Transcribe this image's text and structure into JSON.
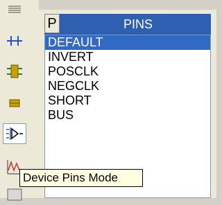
{
  "panel": {
    "header_button_label": "P",
    "title": "PINS",
    "items": [
      "DEFAULT",
      "INVERT",
      "POSCLK",
      "NEGCLK",
      "SHORT",
      "BUS"
    ],
    "selected_item": "DEFAULT"
  },
  "toolbar": {
    "tools": [
      {
        "icon": "grid-lines-icon"
      },
      {
        "icon": "junction-icon"
      },
      {
        "icon": "component-icon"
      },
      {
        "icon": "connector-icon"
      },
      {
        "icon": "device-pins-icon",
        "active": true
      },
      {
        "icon": "graph-icon"
      },
      {
        "icon": "window-icon"
      }
    ]
  },
  "tooltip": {
    "text": "Device Pins Mode"
  },
  "colors": {
    "header_blue": "#2e5fb0",
    "selection_blue": "#316ac5",
    "toolbar_bg": "#ece9d8",
    "tooltip_bg": "#ffffe1"
  }
}
